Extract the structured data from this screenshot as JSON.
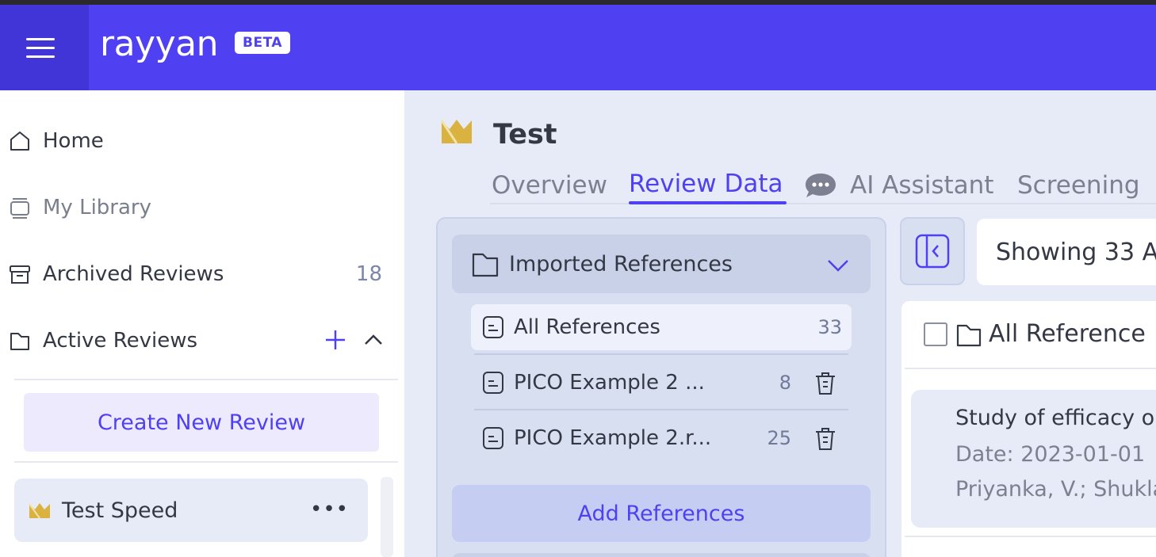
{
  "app": {
    "logo": "rayyan",
    "badge": "BETA"
  },
  "sidebar": {
    "items": [
      {
        "label": "Home",
        "icon": "home-icon"
      },
      {
        "label": "My Library",
        "icon": "library-icon"
      },
      {
        "label": "Archived Reviews",
        "icon": "archive-icon",
        "count": "18"
      },
      {
        "label": "Active Reviews",
        "icon": "folder-icon"
      }
    ],
    "create_label": "Create New Review",
    "reviews": [
      {
        "label": "Test Speed",
        "more": "•••"
      }
    ]
  },
  "project": {
    "title": "Test Speed"
  },
  "tabs": [
    {
      "label": "Overview"
    },
    {
      "label": "Review Data",
      "active": true
    },
    {
      "label": "AI Assistant",
      "icon": "chat-bubble-icon"
    },
    {
      "label": "Screening"
    }
  ],
  "refs": {
    "header": "Imported References",
    "rows": [
      {
        "label": "All References",
        "count": "33"
      },
      {
        "label": "PICO Example 2 ...",
        "count": "8"
      },
      {
        "label": "PICO Example 2.r...",
        "count": "25"
      }
    ],
    "add_label": "Add References"
  },
  "results": {
    "showing": "Showing 33 A",
    "list_title": "All Reference",
    "article": {
      "title": "Study of efficacy o",
      "date": "Date: 2023-01-01",
      "authors": "Priyanka, V.; Shukla"
    }
  },
  "colors": {
    "brand": "#4f40f2",
    "accent_gold": "#d9b23f"
  }
}
